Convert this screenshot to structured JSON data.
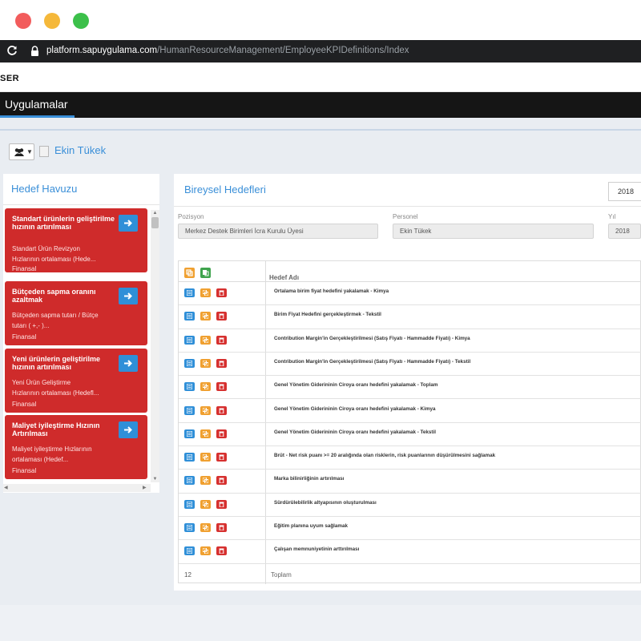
{
  "browser": {
    "url_host": "platform.sapuygulama.com",
    "url_path": "/HumanResourceManagement/EmployeeKPIDefinitions/Index"
  },
  "app": {
    "brand": "SER",
    "nav_tab": "Uygulamalar"
  },
  "profile": {
    "user_name": "Ekin Tükek"
  },
  "left_panel": {
    "title": "Hedef Havuzu",
    "cards": [
      {
        "title": "Standart ürünlerin geliştirilme hızının artırılması",
        "desc_line1": "Standart Ürün Revizyon",
        "desc_line2": "Hızlarının ortalaması (Hede...",
        "category": "Finansal"
      },
      {
        "title": "Bütçeden sapma oranını azaltmak",
        "desc_line1": "Bütçeden sapma tutarı / Bütçe",
        "desc_line2": "tutarı ( +,- )...",
        "category": "Finansal"
      },
      {
        "title": "Yeni ürünlerin geliştirilme hızının artırılması",
        "desc_line1": "Yeni Ürün Geliştirme",
        "desc_line2": "Hızlarının ortalaması (Hedefl...",
        "category": "Finansal"
      },
      {
        "title": "Maliyet iyileştirme Hızının Artırılması",
        "desc_line1": "Maliyet iyileştirme Hızlarının",
        "desc_line2": "ortalaması (Hedef...",
        "category": "Finansal"
      }
    ]
  },
  "right_panel": {
    "title": "Bireysel Hedefleri",
    "year_select": "2018",
    "fields": {
      "position_label": "Pozisyon",
      "position_value": "Merkez Destek Birimleri İcra Kurulu Üyesi",
      "personnel_label": "Personel",
      "personnel_value": "Ekin Tükek",
      "year_label": "Yıl",
      "year_value": "2018"
    },
    "table": {
      "header": "Hedef Adı",
      "rows": [
        "Ortalama birim fiyat hedefini yakalamak - Kimya",
        "Birim Fiyat Hedefini gerçekleştirmek - Tekstil",
        "Contribution Margin'in Gerçekleştirilmesi (Satış Fiyatı - Hammadde Fiyatı) - Kimya",
        "Contribution Margin'in Gerçekleştirilmesi (Satış Fiyatı - Hammadde Fiyatı) - Tekstil",
        "Genel Yönetim Giderininin Ciroya oranı hedefini yakalamak - Toplam",
        "Genel Yönetim Giderininin Ciroya oranı hedefini yakalamak - Kimya",
        "Genel Yönetim Giderininin Ciroya oranı hedefini yakalamak - Tekstil",
        "Brüt - Net risk puanı >= 20 aralığında olan risklerin, risk puanlarının düşürülmesini sağlamak",
        "Marka bilinirliğinin artırılması",
        "Sürdürülebilirlik altyapısının oluşturulması",
        "Eğitim planına uyum sağlamak",
        "Çalışan memnuniyetinin arttırılması"
      ],
      "footer_count": "12",
      "footer_label": "Toplam"
    }
  },
  "colors": {
    "accent_blue": "#3a8fd8",
    "card_red": "#cf2b2b",
    "action_orange": "#f0a030",
    "action_green": "#3fa34d",
    "action_red": "#d6302f"
  }
}
